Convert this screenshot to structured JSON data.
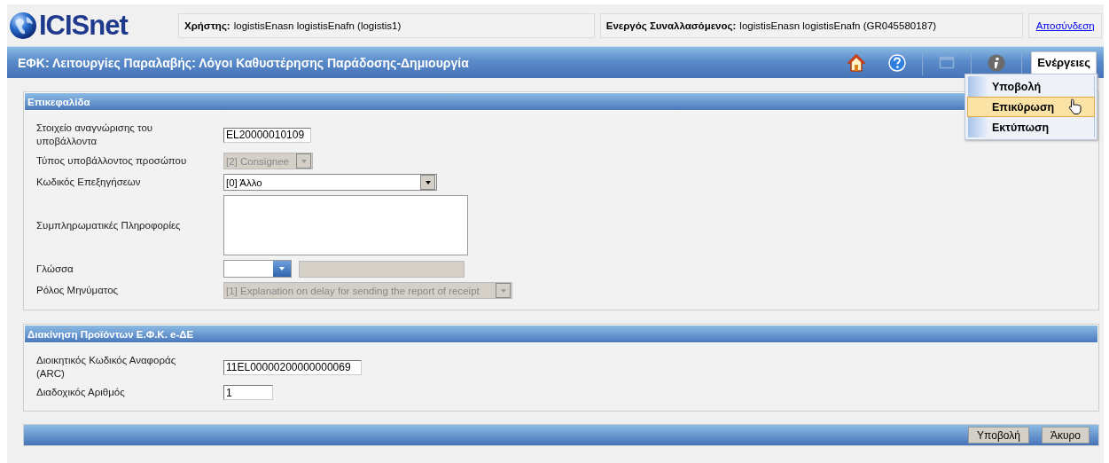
{
  "header": {
    "logo": "ICISnet",
    "user_label": "Χρήστης:",
    "user_value": "logistisEnasn logistisEnafn (logistis1)",
    "trader_label": "Ενεργός Συναλλασόμενος:",
    "trader_value": "logistisEnasn logistisEnafn (GR045580187)",
    "logout": "Αποσύνδεση"
  },
  "title_bar": {
    "title": "ΕΦΚ: Λειτουργίες Παραλαβής: Λόγοι Καθυστέρησης Παράδοσης-Δημιουργία",
    "actions_button": "Ενέργειες"
  },
  "actions_menu": [
    {
      "label": "Υποβολή",
      "selected": false
    },
    {
      "label": "Επικύρωση",
      "selected": true
    },
    {
      "label": "Εκτύπωση",
      "selected": false
    }
  ],
  "sections": [
    {
      "title": "Επικεφαλίδα",
      "fields": [
        {
          "kind": "text",
          "label": "Στοιχείο αναγνώρισης του υποβάλλοντα",
          "value": "EL20000010109",
          "disabled": false
        },
        {
          "kind": "select",
          "label": "Τύπος υποβάλλοντος προσώπου",
          "value": "[2] Consignee",
          "disabled": true
        },
        {
          "kind": "select",
          "label": "Κωδικός Επεξηγήσεων",
          "value": "[0] Άλλο",
          "disabled": false
        },
        {
          "kind": "textarea",
          "label": "Συμπληρωματικές Πληροφορίες"
        },
        {
          "kind": "language",
          "label": "Γλώσσα"
        },
        {
          "kind": "select",
          "label": "Ρόλος Μηνύματος",
          "value": "[1] Explanation on delay for sending the report of receipt",
          "disabled": true
        }
      ]
    },
    {
      "title": "Διακίνηση Προϊόντων Ε.Φ.Κ. e-ΔΕ",
      "fields": [
        {
          "kind": "text",
          "label": "Διοικητικός Κωδικός Αναφοράς (ARC)",
          "value": "11EL00000200000000069",
          "disabled": false
        },
        {
          "kind": "text",
          "label": "Διαδοχικός Αριθμός",
          "value": "1",
          "disabled": false
        }
      ]
    }
  ],
  "footer_buttons": [
    "Υποβολή",
    "Άκυρο"
  ]
}
